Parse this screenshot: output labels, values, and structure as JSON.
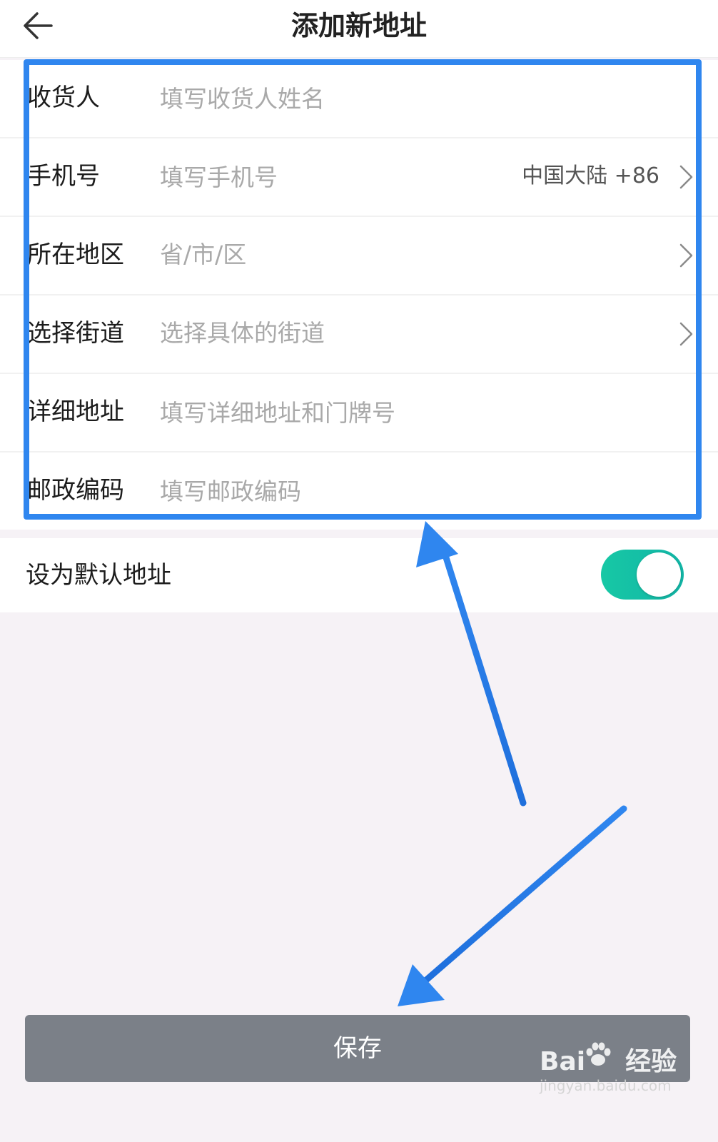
{
  "header": {
    "back_icon": "arrow-left-icon",
    "title": "添加新地址"
  },
  "form": {
    "rows": [
      {
        "label": "收货人",
        "placeholder": "填写收货人姓名"
      },
      {
        "label": "手机号",
        "placeholder": "填写手机号",
        "region": "中国大陆 +86"
      },
      {
        "label": "所在地区",
        "placeholder": "省/市/区"
      },
      {
        "label": "选择街道",
        "placeholder": "选择具体的街道"
      },
      {
        "label": "详细地址",
        "placeholder": "填写详细地址和门牌号"
      },
      {
        "label": "邮政编码",
        "placeholder": "填写邮政编码"
      }
    ]
  },
  "default_address": {
    "label": "设为默认地址",
    "enabled": true
  },
  "save_button": {
    "label": "保存"
  },
  "watermark": {
    "main_a": "Bai",
    "main_b": "经验",
    "sub": "jingyan.baidu.com"
  },
  "colors": {
    "highlight": "#2f86ef",
    "toggle_on": "#17c8a5",
    "save_button_bg": "#7b8088",
    "page_bg": "#f6f2f6"
  }
}
